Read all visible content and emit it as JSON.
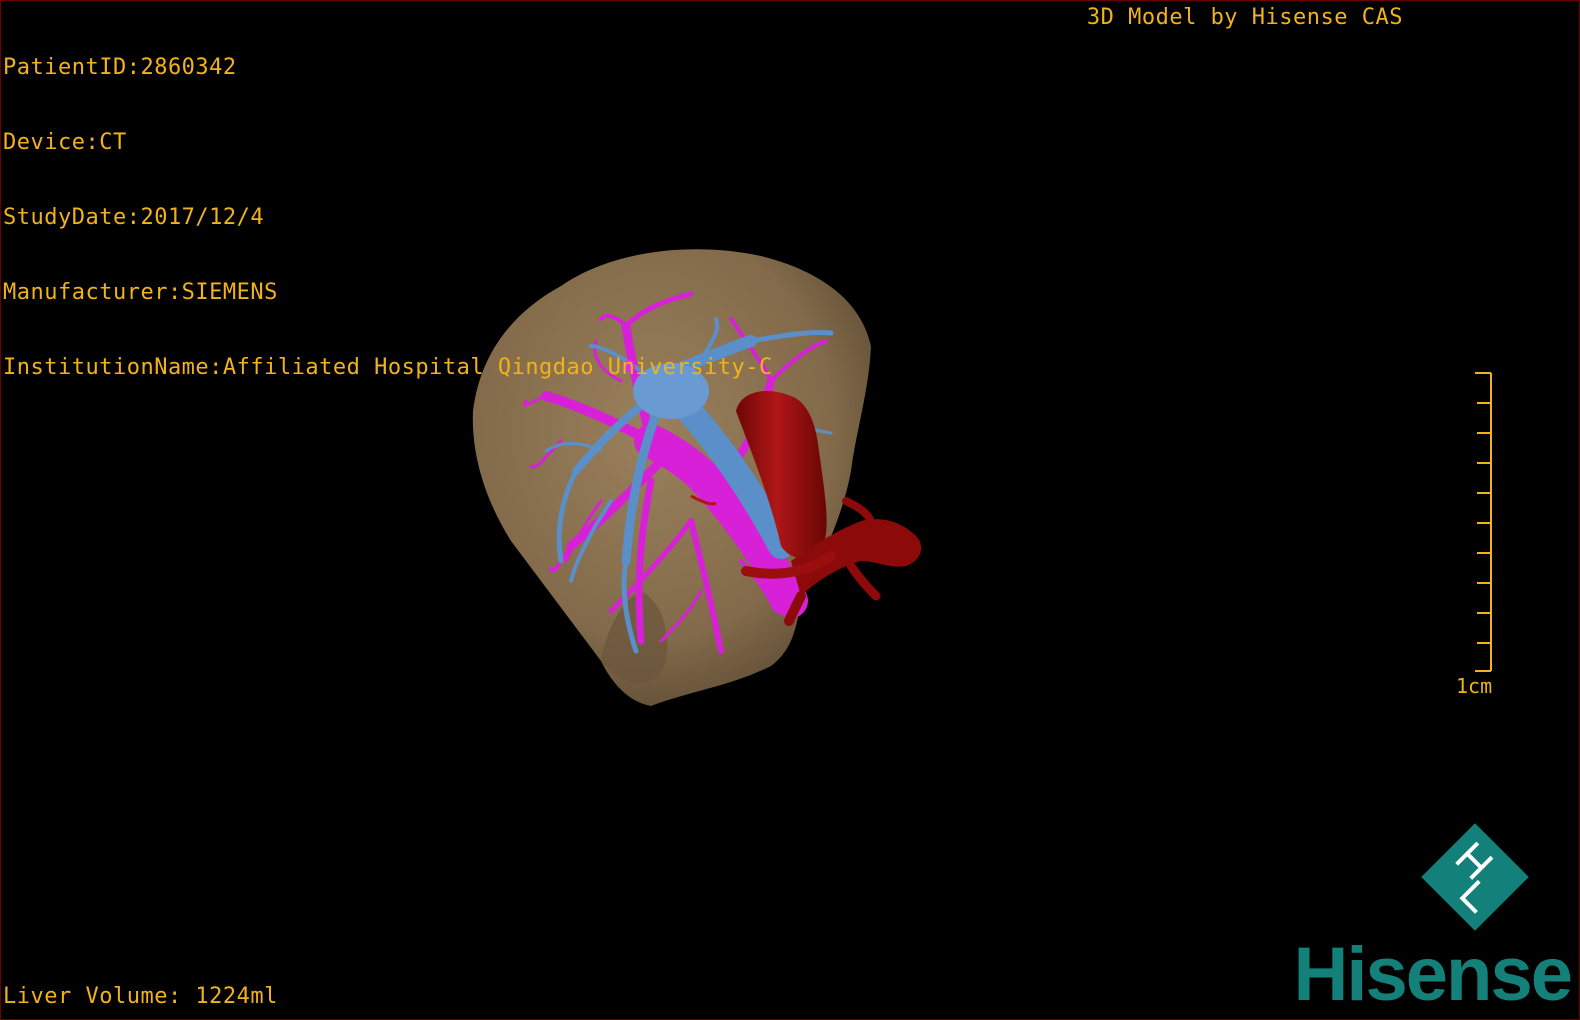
{
  "info": {
    "lines": [
      "PatientID:2860342",
      "Device:CT",
      "StudyDate:2017/12/4",
      "Manufacturer:SIEMENS",
      "InstitutionName:Affiliated Hospital Qingdao University-C"
    ]
  },
  "header": {
    "model_credit": "3D Model by Hisense CAS"
  },
  "footer": {
    "liver_volume": "Liver Volume: 1224ml"
  },
  "scale": {
    "label": "1cm"
  },
  "brand": {
    "name": "Hisense",
    "logo_icon": "hisense-cas-diamond-logo"
  },
  "colors": {
    "overlay_text": "#f2b21a",
    "liver": "#8b7355",
    "portal_vein": "#d820d8",
    "hepatic_vein": "#5b8fc9",
    "inferior_vena_cava": "#9a0e0e",
    "brand": "#13807a"
  }
}
